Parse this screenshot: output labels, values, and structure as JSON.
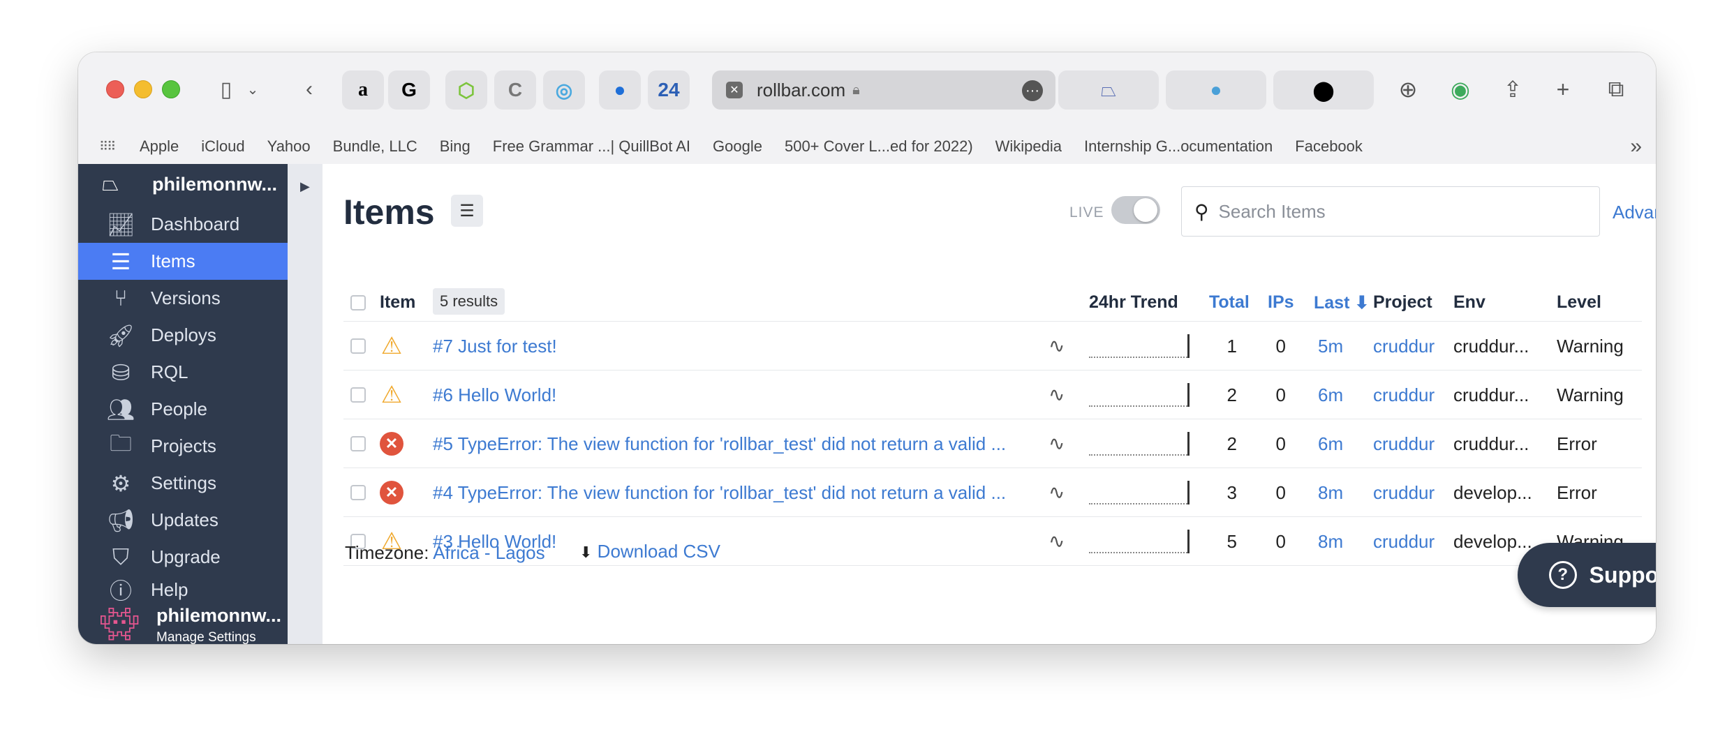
{
  "browser": {
    "url": "rollbar.com",
    "pinned_tabs": [
      "a",
      "G",
      "⬡",
      "C",
      "◎",
      "●",
      "24"
    ],
    "bookmarks": [
      "Apple",
      "iCloud",
      "Yahoo",
      "Bundle, LLC",
      "Bing",
      "Free Grammar ...| QuillBot AI",
      "Google",
      "500+ Cover L...ed for 2022)",
      "Wikipedia",
      "Internship G...ocumentation",
      "Facebook"
    ]
  },
  "sidebar": {
    "org_name": "philemonnw...",
    "items": [
      {
        "label": "Dashboard",
        "icon": "chart-icon"
      },
      {
        "label": "Items",
        "icon": "list-icon"
      },
      {
        "label": "Versions",
        "icon": "branch-icon"
      },
      {
        "label": "Deploys",
        "icon": "rocket-icon"
      },
      {
        "label": "RQL",
        "icon": "database-search-icon"
      },
      {
        "label": "People",
        "icon": "people-icon"
      },
      {
        "label": "Projects",
        "icon": "folder-gear-icon"
      },
      {
        "label": "Settings",
        "icon": "gear-icon"
      },
      {
        "label": "Updates",
        "icon": "megaphone-icon"
      },
      {
        "label": "Upgrade",
        "icon": "shield-up-icon"
      },
      {
        "label": "Help",
        "icon": "help-icon"
      }
    ],
    "user": {
      "name": "philemonnw...",
      "sub": "Manage Settings"
    }
  },
  "main": {
    "title": "Items",
    "live_label": "LIVE",
    "search_placeholder": "Search Items",
    "advanced": "Advanced",
    "columns": {
      "item": "Item",
      "results": "5 results",
      "trend": "24hr Trend",
      "total": "Total",
      "ips": "IPs",
      "last": "Last ⬇",
      "project": "Project",
      "env": "Env",
      "level": "Level"
    },
    "rows": [
      {
        "level_icon": "warning",
        "title": "#7 Just for test!",
        "total": "1",
        "ips": "0",
        "last": "5m",
        "project": "cruddur",
        "env": "cruddur...",
        "level": "Warning"
      },
      {
        "level_icon": "warning",
        "title": "#6 Hello World!",
        "total": "2",
        "ips": "0",
        "last": "6m",
        "project": "cruddur",
        "env": "cruddur...",
        "level": "Warning"
      },
      {
        "level_icon": "error",
        "title": "#5 TypeError: The view function for 'rollbar_test' did not return a valid ...",
        "total": "2",
        "ips": "0",
        "last": "6m",
        "project": "cruddur",
        "env": "cruddur...",
        "level": "Error"
      },
      {
        "level_icon": "error",
        "title": "#4 TypeError: The view function for 'rollbar_test' did not return a valid ...",
        "total": "3",
        "ips": "0",
        "last": "8m",
        "project": "cruddur",
        "env": "develop...",
        "level": "Error"
      },
      {
        "level_icon": "warning",
        "title": "#3 Hello World!",
        "total": "5",
        "ips": "0",
        "last": "8m",
        "project": "cruddur",
        "env": "develop...",
        "level": "Warning"
      }
    ],
    "timezone_label": "Timezone:",
    "timezone_value": "Africa - Lagos",
    "download": "Download CSV",
    "support": "Support"
  }
}
